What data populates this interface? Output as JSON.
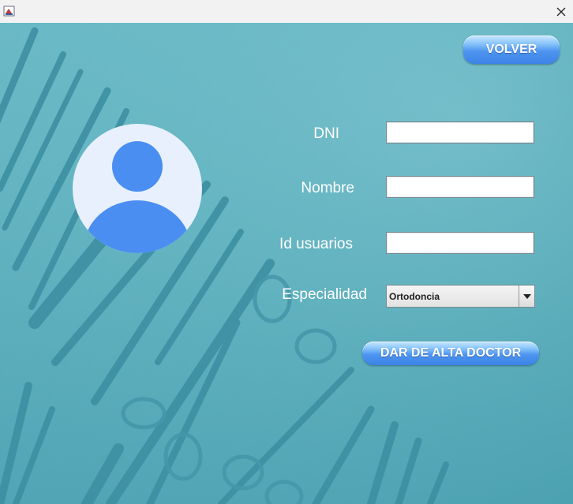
{
  "window": {
    "app_icon": "java-cup-icon",
    "close_icon": "close-icon"
  },
  "form": {
    "dni_label": "DNI",
    "nombre_label": "Nombre",
    "id_usuarios_label": "Id usuarios",
    "especialidad_label": "Especialidad",
    "dni_value": "",
    "nombre_value": "",
    "id_usuarios_value": "",
    "especialidad_value": "Ortodoncia"
  },
  "buttons": {
    "volver": "VOLVER",
    "dar_de_alta": "DAR DE ALTA DOCTOR"
  },
  "colors": {
    "background_teal": "#5fb0c0",
    "instrument": "#3b8fa3",
    "avatar_circle": "#e8f0fe",
    "avatar_figure": "#4a8ef2",
    "button_blue": "#4e95f0"
  }
}
